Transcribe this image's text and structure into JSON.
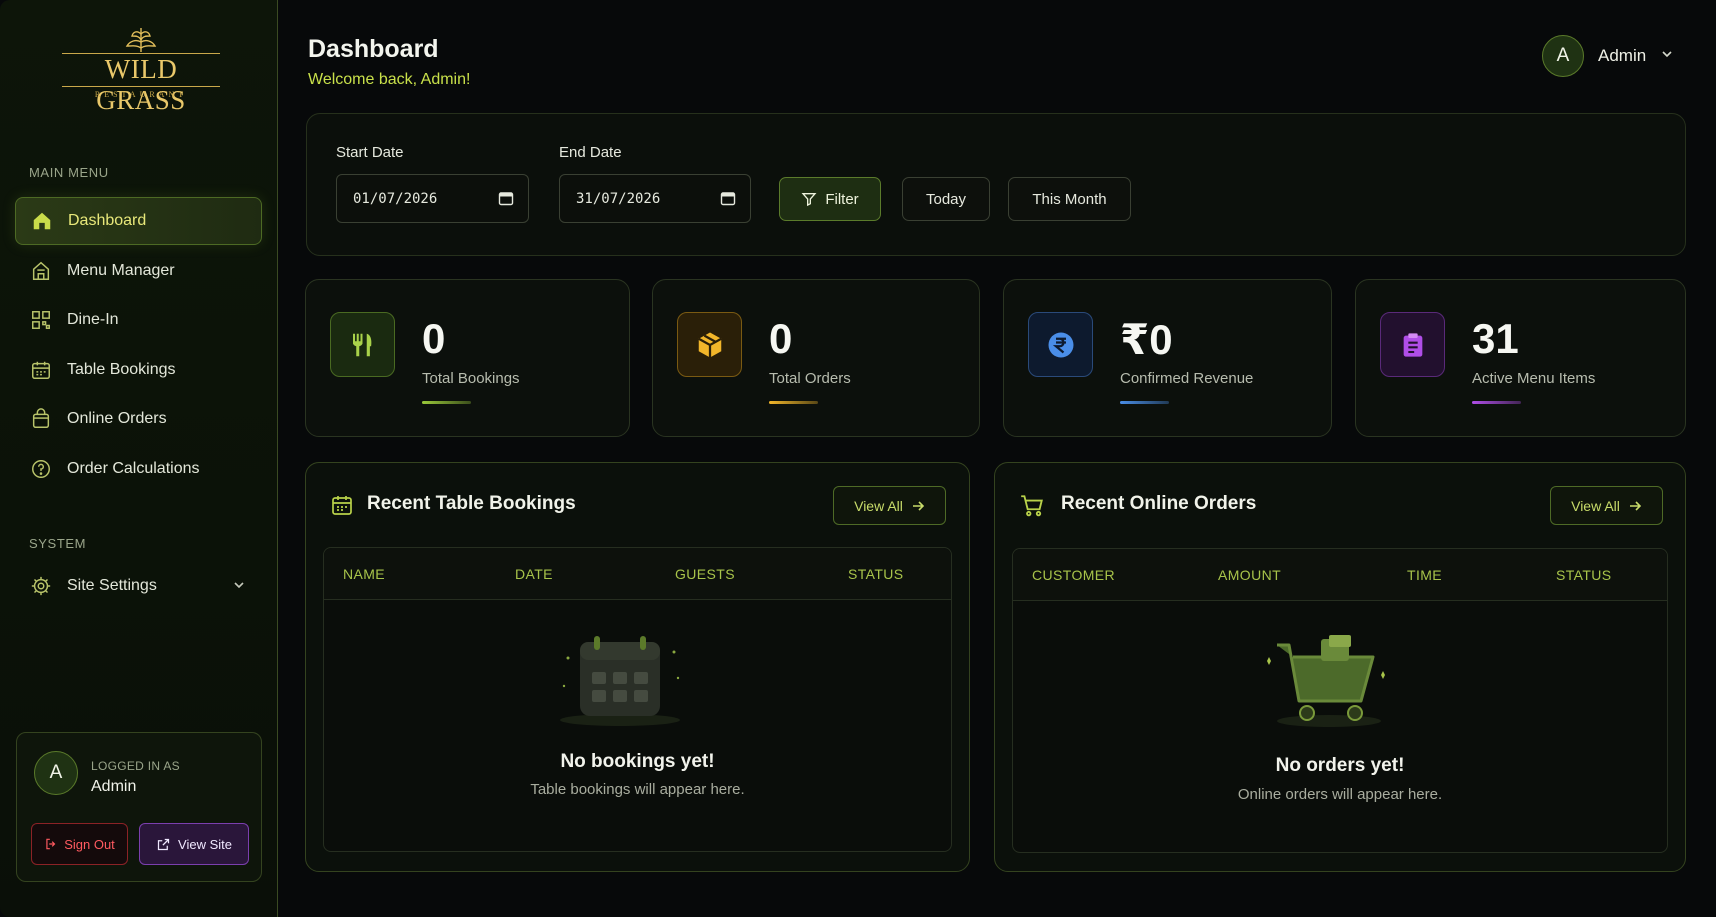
{
  "brand": {
    "name": "WILD GRASS",
    "tagline": "RESTAURANT"
  },
  "sidebar": {
    "main_menu_label": "MAIN MENU",
    "items": [
      {
        "label": "Dashboard",
        "icon": "home-icon"
      },
      {
        "label": "Menu Manager",
        "icon": "store-icon"
      },
      {
        "label": "Dine-In",
        "icon": "qr-code-icon"
      },
      {
        "label": "Table Bookings",
        "icon": "calendar-icon"
      },
      {
        "label": "Online Orders",
        "icon": "shopping-bag-icon"
      },
      {
        "label": "Order Calculations",
        "icon": "help-circle-icon"
      }
    ],
    "system_label": "SYSTEM",
    "settings_label": "Site Settings",
    "user": {
      "initial": "A",
      "logged_in_label": "LOGGED IN AS",
      "name": "Admin",
      "sign_out": "Sign Out",
      "view_site": "View Site"
    }
  },
  "header": {
    "title": "Dashboard",
    "subtitle": "Welcome back, Admin!",
    "user_initial": "A",
    "user_name": "Admin"
  },
  "filters": {
    "start_label": "Start Date",
    "start_value": "01/07/2026",
    "end_label": "End Date",
    "end_value": "31/07/2026",
    "filter_button": "Filter",
    "today_button": "Today",
    "month_button": "This Month"
  },
  "stats": [
    {
      "value": "0",
      "label": "Total Bookings",
      "color": "#9ac93a",
      "fill": 0.75
    },
    {
      "value": "0",
      "label": "Total Orders",
      "color": "#f2b62a",
      "fill": 0.75
    },
    {
      "value": "₹0",
      "label": "Confirmed Revenue",
      "color": "#4a8ee8",
      "fill": 0.75
    },
    {
      "value": "31",
      "label": "Active Menu Items",
      "color": "#b04ee8",
      "fill": 0.75
    }
  ],
  "bookings": {
    "title": "Recent Table Bookings",
    "view_all": "View All",
    "columns": [
      "NAME",
      "DATE",
      "GUESTS",
      "STATUS"
    ],
    "empty_title": "No bookings yet!",
    "empty_sub": "Table bookings will appear here."
  },
  "orders": {
    "title": "Recent Online Orders",
    "view_all": "View All",
    "columns": [
      "CUSTOMER",
      "AMOUNT",
      "TIME",
      "STATUS"
    ],
    "empty_title": "No orders yet!",
    "empty_sub": "Online orders will appear here."
  }
}
